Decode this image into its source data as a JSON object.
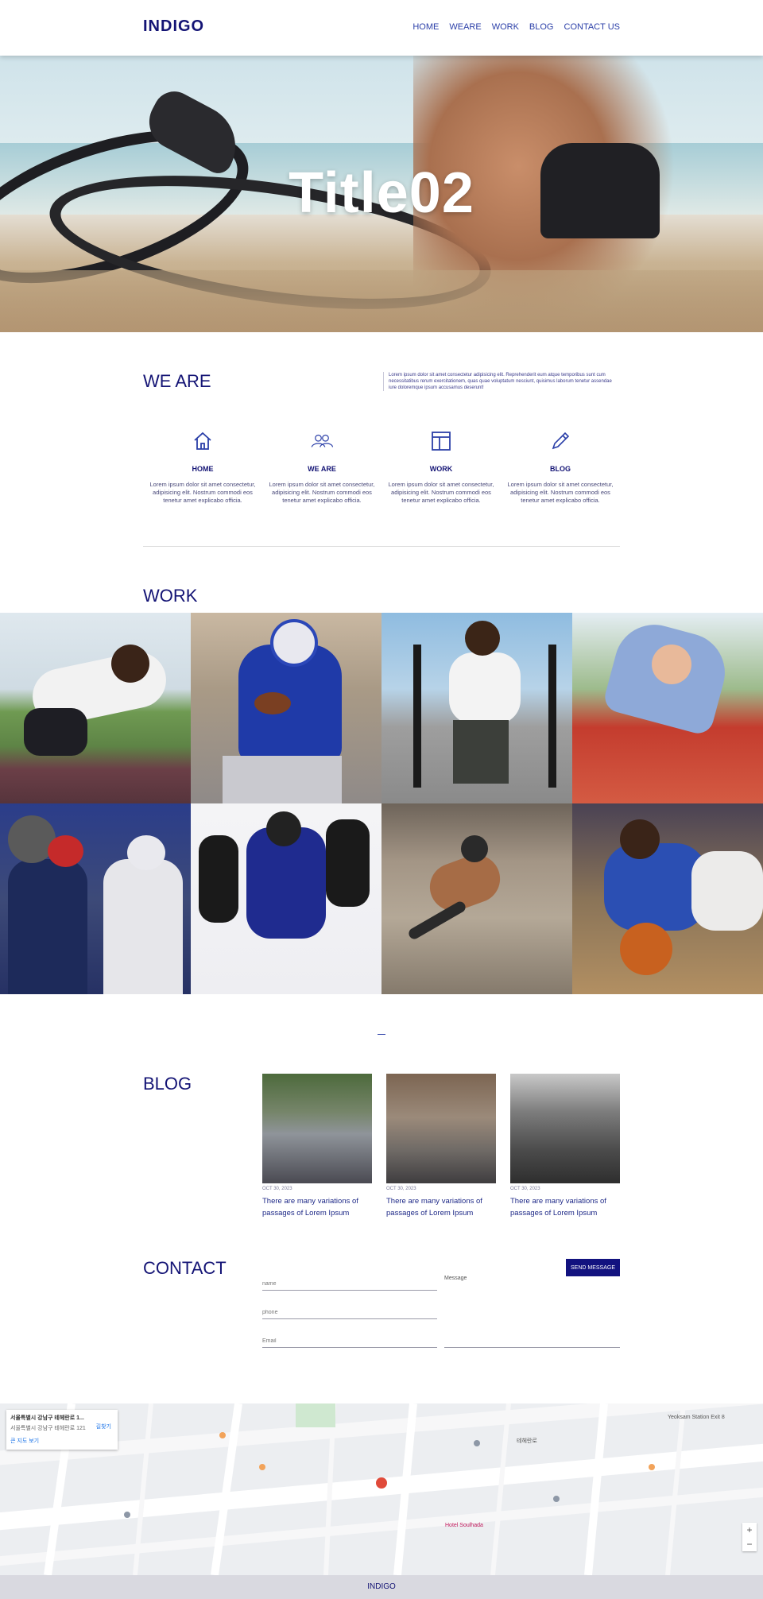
{
  "header": {
    "logo": "INDIGO",
    "nav": [
      "HOME",
      "WEARE",
      "WORK",
      "BLOG",
      "CONTACT US"
    ]
  },
  "hero": {
    "title": "Title02"
  },
  "weare": {
    "title": "WE ARE",
    "intro": "Lorem ipsum dolor sit amet consectetur adipisicing elit. Reprehenderit eum atque temporibus sunt cum necessitatibus rerum exercitationem, quas quae voluptatum nesciunt, quisimus laborum tenetur assendae iure doloremque ipsum accusamus deserunt!",
    "features": [
      {
        "icon": "home-icon",
        "label": "HOME",
        "desc": "Lorem ipsum dolor sit amet consectetur, adipisicing elit. Nostrum commodi eos tenetur amet explicabo officia."
      },
      {
        "icon": "people-icon",
        "label": "WE ARE",
        "desc": "Lorem ipsum dolor sit amet consectetur, adipisicing elit. Nostrum commodi eos tenetur amet explicabo officia."
      },
      {
        "icon": "layout-icon",
        "label": "WORK",
        "desc": "Lorem ipsum dolor sit amet consectetur, adipisicing elit. Nostrum commodi eos tenetur amet explicabo officia."
      },
      {
        "icon": "pencil-icon",
        "label": "BLOG",
        "desc": "Lorem ipsum dolor sit amet consectetur, adipisicing elit. Nostrum commodi eos tenetur amet explicabo officia."
      }
    ]
  },
  "work": {
    "title": "WORK"
  },
  "blog": {
    "title": "BLOG",
    "posts": [
      {
        "date": "OCT 30, 2023",
        "title": "There are many variations of passages of Lorem Ipsum"
      },
      {
        "date": "OCT 30, 2023",
        "title": "There are many variations of passages of Lorem Ipsum"
      },
      {
        "date": "OCT 30, 2023",
        "title": "There are many variations of passages of Lorem Ipsum"
      }
    ]
  },
  "contact": {
    "title": "CONTACT",
    "name_placeholder": "name",
    "phone_placeholder": "phone",
    "email_placeholder": "Email",
    "message_label": "Message",
    "send_label": "SEND MESSAGE"
  },
  "map": {
    "place_title": "서울특별시 강남구 테헤란로 1...",
    "place_address": "서울특별시 강남구 테헤란로 121",
    "directions": "길찾기",
    "larger_map": "큰 지도 보기",
    "station": "Yeoksam Station Exit 8",
    "road": "테헤란로",
    "hotel": "Hotel Soulhada"
  },
  "footer": {
    "text": "INDIGO"
  },
  "colors": {
    "brand": "#141475",
    "accent": "#12127f",
    "nav": "#2b3fa8"
  }
}
